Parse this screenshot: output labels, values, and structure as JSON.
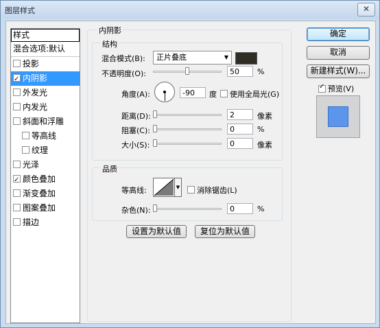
{
  "window": {
    "title": "图层样式",
    "close_glyph": "✕"
  },
  "styles": {
    "header": "样式",
    "blend_options": "混合选项:默认",
    "items": [
      {
        "label": "投影",
        "checked": false,
        "indent": false
      },
      {
        "label": "内阴影",
        "checked": true,
        "indent": false,
        "selected": true
      },
      {
        "label": "外发光",
        "checked": false,
        "indent": false
      },
      {
        "label": "内发光",
        "checked": false,
        "indent": false
      },
      {
        "label": "斜面和浮雕",
        "checked": false,
        "indent": false
      },
      {
        "label": "等高线",
        "checked": false,
        "indent": true
      },
      {
        "label": "纹理",
        "checked": false,
        "indent": true
      },
      {
        "label": "光泽",
        "checked": false,
        "indent": false
      },
      {
        "label": "颜色叠加",
        "checked": true,
        "indent": false
      },
      {
        "label": "渐变叠加",
        "checked": false,
        "indent": false
      },
      {
        "label": "图案叠加",
        "checked": false,
        "indent": false
      },
      {
        "label": "描边",
        "checked": false,
        "indent": false
      }
    ]
  },
  "inner_shadow": {
    "section_title": "内阴影",
    "structure": {
      "title": "结构",
      "blend_mode_label": "混合模式(B):",
      "blend_mode_value": "正片叠底",
      "shadow_color": "#302d27",
      "opacity_label": "不透明度(O):",
      "opacity_value": "50",
      "opacity_percent": 50,
      "angle_label": "角度(A):",
      "angle_value": "-90",
      "angle_unit": "度",
      "global_light_label": "使用全局光(G)",
      "global_light_checked": false,
      "distance_label": "距离(D):",
      "distance_value": "2",
      "distance_unit": "像素",
      "choke_label": "阻塞(C):",
      "choke_value": "0",
      "size_label": "大小(S):",
      "size_value": "0",
      "size_unit": "像素",
      "percent": "%"
    },
    "quality": {
      "title": "品质",
      "contour_label": "等高线:",
      "anti_alias_label": "消除锯齿(L)",
      "anti_alias_checked": false,
      "noise_label": "杂色(N):",
      "noise_value": "0",
      "percent": "%"
    },
    "make_default": "设置为默认值",
    "reset_default": "复位为默认值"
  },
  "actions": {
    "ok": "确定",
    "cancel": "取消",
    "new_style": "新建样式(W)...",
    "preview_label": "预览(V)",
    "preview_checked": true,
    "preview_color": "#5b95ec"
  }
}
